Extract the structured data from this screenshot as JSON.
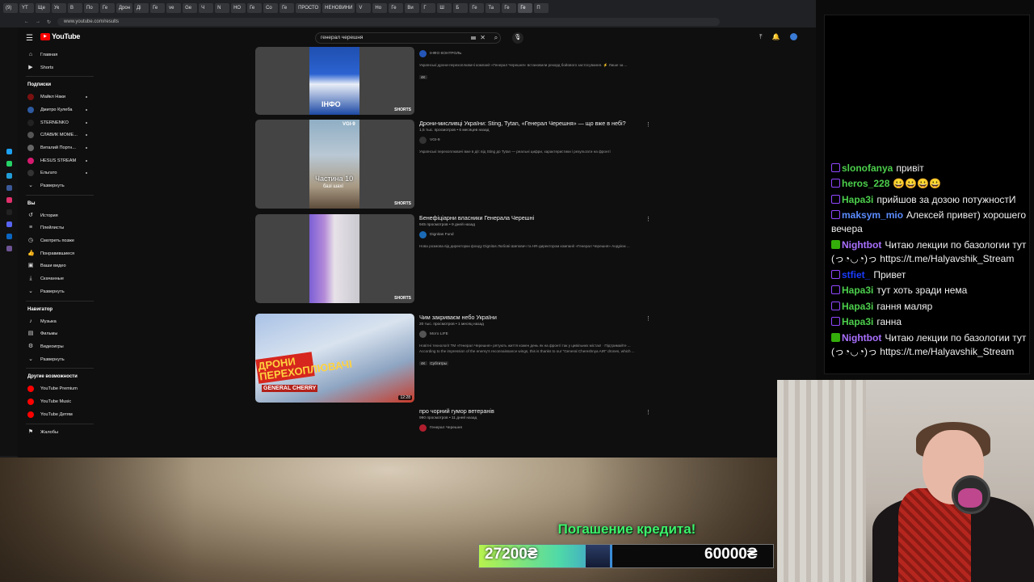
{
  "browser": {
    "tabs": [
      "(9)",
      "YT",
      "Ще",
      "Ук",
      "В",
      "По",
      "Ге",
      "Дрон",
      "Ді",
      "Ге",
      "ve",
      "Ge",
      "Ч",
      "N",
      "НО",
      "Ге",
      "Со",
      "Ге",
      "ПРОСТО",
      "НЕНОВИНИ",
      "V",
      "Но",
      "Ге",
      "Ви",
      "Г",
      "Ш",
      "Б",
      "Ге",
      "Та",
      "Ге",
      "Ге",
      "П"
    ],
    "active_tab_index": 30,
    "url": "www.youtube.com/results"
  },
  "youtube": {
    "logo_text": "YouTube",
    "search_value": "генерал черешня",
    "sidebar": {
      "top": [
        {
          "label": "Главная",
          "icon": "home-icon"
        },
        {
          "label": "Shorts",
          "icon": "shorts-icon"
        }
      ],
      "subs_title": "Подписки",
      "subs": [
        {
          "label": "Майкл Наки",
          "color": "#7a1010"
        },
        {
          "label": "Дмитро Кулеба",
          "color": "#2d5aa0"
        },
        {
          "label": "STERNENKO",
          "color": "#222"
        },
        {
          "label": "СЛАВИК МОМЕ...",
          "color": "#555"
        },
        {
          "label": "Виталий Портн...",
          "color": "#666"
        },
        {
          "label": "HESUS STREAM",
          "color": "#d61a6f"
        },
        {
          "label": "Ельгато",
          "color": "#333"
        },
        {
          "label": "Развернуть",
          "color": ""
        }
      ],
      "you_title": "Вы",
      "you": [
        {
          "label": "История",
          "icon": "history-icon"
        },
        {
          "label": "Плейлисты",
          "icon": "playlists-icon"
        },
        {
          "label": "Смотреть позже",
          "icon": "watch-later-icon"
        },
        {
          "label": "Понравившиеся",
          "icon": "like-icon"
        },
        {
          "label": "Ваши видео",
          "icon": "your-videos-icon"
        },
        {
          "label": "Скачанные",
          "icon": "download-icon"
        },
        {
          "label": "Развернуть",
          "icon": "chevron-down-icon"
        }
      ],
      "nav_title": "Навигатор",
      "nav": [
        {
          "label": "Музыка",
          "icon": "music-icon"
        },
        {
          "label": "Фильмы",
          "icon": "movies-icon"
        },
        {
          "label": "Видеоигры",
          "icon": "gaming-icon"
        },
        {
          "label": "Развернуть",
          "icon": "chevron-down-icon"
        }
      ],
      "more_title": "Другие возможности",
      "more": [
        {
          "label": "YouTube Premium",
          "color": "#ff0000"
        },
        {
          "label": "YouTube Music",
          "color": "#ff0000"
        },
        {
          "label": "YouTube Детям",
          "color": "#ff0000"
        }
      ],
      "bottom": [
        {
          "label": "Жалобы",
          "icon": "flag-icon"
        }
      ]
    },
    "results": [
      {
        "title": "",
        "stats": "",
        "channel": "ІНФО КОНТРОЛЬ",
        "desc": "Українські дрони-перехоплювачі компанії «Генерал Черешня» встановили рекорд бойового застосування. ⚡ Лише за ...",
        "badges": [
          "4K"
        ],
        "label": "SHORTS",
        "thumb_text": "ІНФО"
      },
      {
        "title": "Дрони-мисливці України: Sting, Tytan, «Генерал Черешня» — що вже в небі?",
        "stats": "1,5 тыс. просмотров • 6 месяцев назад",
        "channel": "VGI-9",
        "desc": "Українські перехоплювачі вже в дії: від Sting до Tytan — реальні цифри, характеристики і результати на фронті",
        "badges": [],
        "label": "SHORTS",
        "thumb_text": "Частина 10",
        "thumb_sub": "базі шахі",
        "thumb_top": "VGI-9"
      },
      {
        "title": "Бенефіціарни власники Генерала Черешні",
        "stats": "945 просмотров • 9 дней назад",
        "channel": "Dignitas Fund",
        "desc": "Нова розмова від директорки фонду Dignitas Любові Шипович та HR-директором компанії «Генерал Черешня» Андрієм ...",
        "badges": [],
        "label": "SHORTS"
      },
      {
        "title": "Чим закриваєм небо України",
        "stats": "20 тыс. просмотров • 1 месяц назад",
        "channel": "Мото LIFE",
        "desc": "Новітні технології ТМ «Генерал Черешня» рятують життя кожен день як на фронті так у цивільних містах! · Підтримайте ...",
        "desc2": "According to the impression of the enemy's reconnaissance wings, this is thanks to our \"General Chereshnya AIR\" drones, which ...",
        "badges": [
          "4K",
          "Субтитры"
        ],
        "label": "12:28",
        "thumb_text": "ДРОНИ ПЕРЕХОПЛЮВАЧІ",
        "thumb_sub": "GENERAL CHERRY"
      },
      {
        "title": "про чорний гумор ветеранів",
        "stats": "990 просмотров • 11 дней назад",
        "channel": "Генерал Черешня",
        "desc": "",
        "badges": []
      }
    ]
  },
  "chat": {
    "messages": [
      {
        "user": "slonofanya",
        "color": "#4ccf4c",
        "text": "привіт",
        "badge": "sub"
      },
      {
        "user": "heros_228",
        "color": "#4ccf4c",
        "text": "😀😀😀😀",
        "badge": "sub"
      },
      {
        "user": "Нара3і",
        "color": "#4ccf4c",
        "text": "прийшов за дозою потужностИ",
        "badge": "sub"
      },
      {
        "user": "maksym_mio",
        "color": "#5b8cff",
        "text": "Алексей привет)  хорошего вечера",
        "badge": "sub"
      },
      {
        "user": "Nightbot",
        "color": "#a970ff",
        "text": "Читаю лекции по базологии тут (っ◔◡◔)っ https://t.me/Halyavshik_Stream",
        "badge": "mod"
      },
      {
        "user": "stfiet_",
        "color": "#1a3cff",
        "text": "Привет",
        "badge": "sub"
      },
      {
        "user": "Нара3і",
        "color": "#4ccf4c",
        "text": "тут хоть зради нема",
        "badge": "sub"
      },
      {
        "user": "Нара3і",
        "color": "#4ccf4c",
        "text": "гання маляр",
        "badge": "sub"
      },
      {
        "user": "Нара3і",
        "color": "#4ccf4c",
        "text": "ганна",
        "badge": "sub"
      },
      {
        "user": "Nightbot",
        "color": "#a970ff",
        "text": "Читаю лекции по базологии тут (っ◔◡◔)っ https://t.me/Halyavshik_Stream",
        "badge": "mod"
      }
    ]
  },
  "goal": {
    "title": "Погашение кредита!",
    "current": "27200₴",
    "target": "60000₴",
    "progress": 0.45
  }
}
